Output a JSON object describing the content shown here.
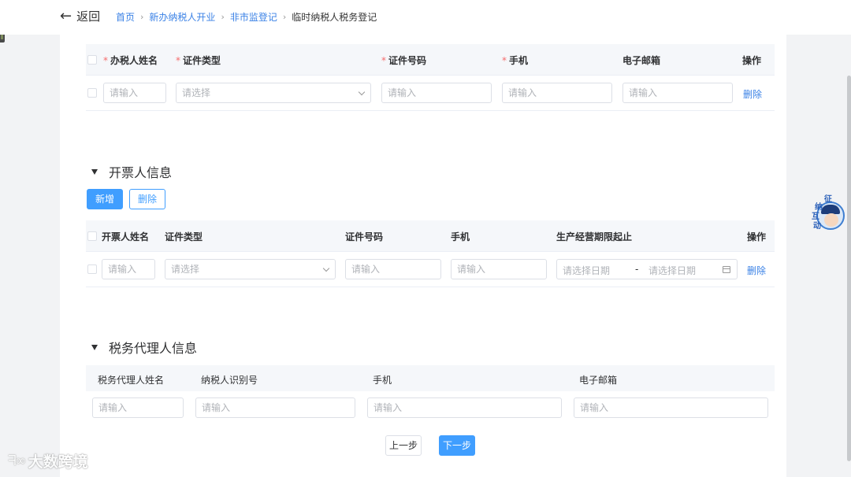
{
  "nav": {
    "back_label": "返回",
    "breadcrumb": [
      "首页",
      "新办纳税人开业",
      "非市监登记"
    ],
    "current": "临时纳税人税务登记"
  },
  "taxpayer_table": {
    "headers": [
      "办税人姓名",
      "证件类型",
      "证件号码",
      "手机",
      "电子邮箱",
      "操作"
    ],
    "required_mark": "*",
    "row": {
      "name_placeholder": "请输入",
      "id_type_placeholder": "请选择",
      "id_no_placeholder": "请输入",
      "phone_placeholder": "请输入",
      "email_placeholder": "请输入",
      "delete": "删除"
    }
  },
  "invoicer": {
    "title": "开票人信息",
    "add_button": "新增",
    "delete_button": "删除",
    "headers": [
      "开票人姓名",
      "证件类型",
      "证件号码",
      "手机",
      "生产经营期限起止",
      "操作"
    ],
    "row": {
      "name_placeholder": "请输入",
      "id_type_placeholder": "请选择",
      "id_no_placeholder": "请输入",
      "phone_placeholder": "请输入",
      "start_date_placeholder": "请选择日期",
      "range_sep": "-",
      "end_date_placeholder": "请选择日期",
      "delete": "删除"
    }
  },
  "agent": {
    "title": "税务代理人信息",
    "headers": [
      "税务代理人姓名",
      "纳税人识别号",
      "手机",
      "电子邮箱"
    ],
    "placeholders": [
      "请输入",
      "请输入",
      "请输入",
      "请输入"
    ]
  },
  "footer": {
    "prev": "上一步",
    "next": "下一步"
  },
  "float_widget": {
    "chars": [
      "征",
      "纳",
      "互",
      "动"
    ]
  },
  "watermark": {
    "text": "大数跨境"
  },
  "colors": {
    "primary": "#409eff",
    "link": "#3b82e6",
    "required": "#f56c6c"
  }
}
